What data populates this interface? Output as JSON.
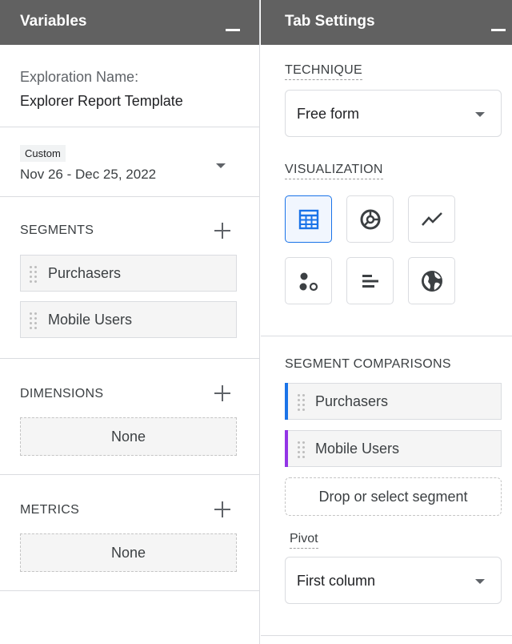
{
  "variables_panel": {
    "title": "Variables",
    "exploration_name_label": "Exploration Name:",
    "exploration_name_value": "Explorer Report Template",
    "date_chip": "Custom",
    "date_range": "Nov 26 - Dec 25, 2022",
    "segments": {
      "title": "SEGMENTS",
      "items": [
        {
          "label": "Purchasers"
        },
        {
          "label": "Mobile Users"
        }
      ]
    },
    "dimensions": {
      "title": "DIMENSIONS",
      "empty_label": "None"
    },
    "metrics": {
      "title": "METRICS",
      "empty_label": "None"
    }
  },
  "tab_settings_panel": {
    "title": "Tab Settings",
    "technique": {
      "title": "TECHNIQUE",
      "selected": "Free form"
    },
    "visualization": {
      "title": "VISUALIZATION",
      "options": [
        {
          "icon": "table-icon",
          "active": true
        },
        {
          "icon": "donut-chart-icon",
          "active": false
        },
        {
          "icon": "line-chart-icon",
          "active": false
        },
        {
          "icon": "scatter-plot-icon",
          "active": false
        },
        {
          "icon": "bar-chart-icon",
          "active": false
        },
        {
          "icon": "globe-icon",
          "active": false
        }
      ]
    },
    "segment_comparisons": {
      "title": "SEGMENT COMPARISONS",
      "items": [
        {
          "label": "Purchasers",
          "color": "#1a73e8"
        },
        {
          "label": "Mobile Users",
          "color": "#9334e6"
        }
      ],
      "drop_label": "Drop or select segment"
    },
    "pivot": {
      "label": "Pivot",
      "selected": "First column"
    }
  },
  "colors": {
    "header_bg": "#616161",
    "accent_blue": "#1a73e8",
    "accent_purple": "#9334e6"
  }
}
